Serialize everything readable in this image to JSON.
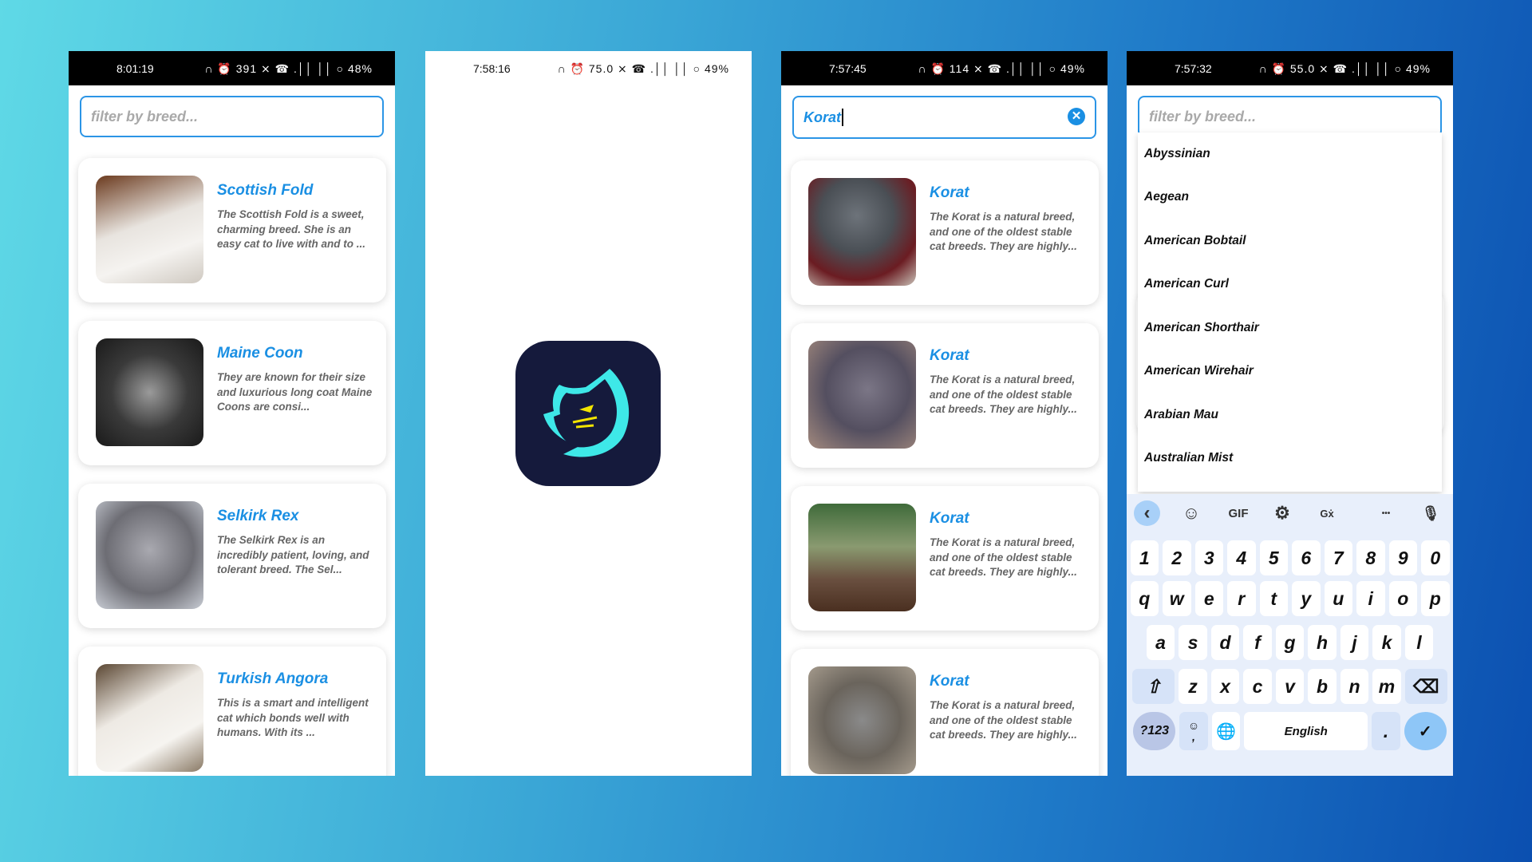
{
  "screens": [
    {
      "status": {
        "time": "8:01:19",
        "icons": "∩ ⏰ 391 ⨯ ☎ .││ ││ ○",
        "battery": "48%"
      },
      "search": {
        "placeholder": "filter by breed..."
      },
      "cards": [
        {
          "title": "Scottish Fold",
          "desc": "The Scottish Fold is a sweet, charming breed. She is an easy cat to live with and to ..."
        },
        {
          "title": "Maine Coon",
          "desc": "They are known for their size and luxurious long coat Maine Coons are consi..."
        },
        {
          "title": "Selkirk Rex",
          "desc": "The Selkirk Rex is an incredibly patient, loving, and tolerant breed. The Sel..."
        },
        {
          "title": "Turkish Angora",
          "desc": "This is a smart and intelligent cat which bonds well with humans. With its ..."
        }
      ]
    },
    {
      "status": {
        "time": "7:58:16",
        "icons": "∩ ⏰ 75.0 ⨯ ☎ .││ ││ ○",
        "battery": "49%"
      },
      "logo": {
        "name": "cat-head-logo",
        "colors": {
          "bg": "#151a3c",
          "outline": "#3ee8e8",
          "eyes": "#f2e400"
        }
      }
    },
    {
      "status": {
        "time": "7:57:45",
        "icons": "∩ ⏰ 114 ⨯ ☎ .││ ││ ○",
        "battery": "49%"
      },
      "search": {
        "value": "Korat"
      },
      "cards": [
        {
          "title": "Korat",
          "desc": "The Korat is a natural breed, and one of the oldest stable cat breeds. They are highly..."
        },
        {
          "title": "Korat",
          "desc": "The Korat is a natural breed, and one of the oldest stable cat breeds. They are highly..."
        },
        {
          "title": "Korat",
          "desc": "The Korat is a natural breed, and one of the oldest stable cat breeds. They are highly..."
        },
        {
          "title": "Korat",
          "desc": "The Korat is a natural breed, and one of the oldest stable cat breeds. They are highly..."
        }
      ]
    },
    {
      "status": {
        "time": "7:57:32",
        "icons": "∩ ⏰ 55.0 ⨯ ☎ .││ ││ ○",
        "battery": "49%"
      },
      "search": {
        "placeholder": "filter by breed..."
      },
      "options": [
        "Abyssinian",
        "Aegean",
        "American Bobtail",
        "American Curl",
        "American Shorthair",
        "American Wirehair",
        "Arabian Mau",
        "Australian Mist"
      ],
      "keyboard": {
        "toolbar": {
          "back": "‹",
          "sticker": "☺",
          "gif": "GIF",
          "settings": "⚙",
          "translate": "Gẋ",
          "more": "•••",
          "mic": "🎙"
        },
        "rows": [
          [
            "1",
            "2",
            "3",
            "4",
            "5",
            "6",
            "7",
            "8",
            "9",
            "0"
          ],
          [
            "q",
            "w",
            "e",
            "r",
            "t",
            "y",
            "u",
            "i",
            "o",
            "p"
          ],
          [
            "a",
            "s",
            "d",
            "f",
            "g",
            "h",
            "j",
            "k",
            "l"
          ],
          [
            "z",
            "x",
            "c",
            "v",
            "b",
            "n",
            "m"
          ]
        ],
        "shift": "⇧",
        "backspace": "⌫",
        "symbols": "?123",
        "comma": ",",
        "emoji": "☺",
        "globe": "🌐",
        "space": "English",
        "period": ".",
        "enter": "✓"
      }
    }
  ],
  "colors": {
    "accent": "#1a8fe3",
    "desc": "#666666",
    "keyboard_bg": "#e8effb"
  }
}
